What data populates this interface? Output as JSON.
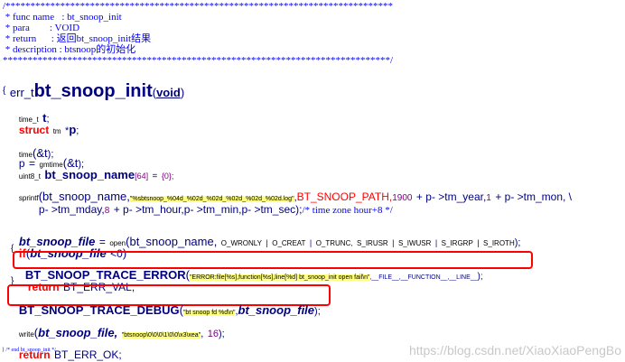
{
  "header": {
    "line1": "/******************************************************************************",
    "line2": " * func name   : bt_snoop_init",
    "line3": " * para        : VOID",
    "line4": " * return      : 返回bt_snoop_init结果",
    "line5": " * description : btsnoop的初始化",
    "line6": "******************************************************************************/"
  },
  "sig": {
    "ret": "err_t",
    "name": "bt_snoop_init",
    "paren_open": "(",
    "arg": "void",
    "paren_close": ")"
  },
  "brace_open": "{",
  "decl1": {
    "type": "time_t",
    "var": "t",
    "semi": ";"
  },
  "decl2": {
    "kw": "struct",
    "type": "tm",
    "star": "*",
    "var": "p",
    "semi": ";"
  },
  "call_time": {
    "fn": "time",
    "open": "(",
    "arg": "&t",
    "close": ");"
  },
  "call_gm": {
    "lhs": "p",
    "eq": "=",
    "fn": "gmtime",
    "open": "(",
    "arg": "&t",
    "close": ");"
  },
  "decl3": {
    "type": "uint8_t",
    "var": "bt_snoop_name",
    "dim": "[64]",
    "eq": "=",
    "init": "{0};"
  },
  "sprintf": {
    "fn": "sprintf",
    "open": "(",
    "arg1": "bt_snoop_name,",
    "fmt": "\"%sbtsnoop_%04d_%02d_%02d_%02d_%02d_%02d.log\"",
    "comma1": ",",
    "path": "BT_SNOOP_PATH,",
    "n1900": "1900",
    "rest1": "+ p- >tm_year,",
    "n1": "1",
    "rest2": "+ p- >tm_mon, \\",
    "rest3": "p- >tm_mday,",
    "n8": "8",
    "rest4": "+ p- >tm_hour,p- >tm_min,p- >tm_sec);",
    "comment": "/* time zone hour+8 */"
  },
  "open_line": {
    "lhs": "bt_snoop_file",
    "eq": "=",
    "fn": "open",
    "open": "(",
    "arg": "bt_snoop_name,",
    "f1": "O_WRONLY",
    "f2": "O_CREAT",
    "f3": "O_TRUNC,",
    "f4": "S_IRUSR",
    "f5": "S_IWUSR",
    "f6": "S_IRGRP",
    "f7": "S_IROTH",
    "pipe": "|",
    "close": ");"
  },
  "if_line": {
    "kw": "if",
    "open": "(",
    "var": "bt_snoop_file",
    "cmp": "<0",
    "close": ")"
  },
  "inner_brace": "{",
  "trace_err": {
    "fn": "BT_SNOOP_TRACE_ERROR",
    "open": "(",
    "msg": "\"ERROR:file[%s],function[%s],line[%d] bt_snoop_init open fail\\n\"",
    "args": ",__FILE__,__FUNCTION__,__LINE__",
    "close": ");"
  },
  "ret_err": {
    "kw": "return",
    "val": "BT_ERR_VAL;"
  },
  "inner_brace_close": "}",
  "trace_dbg": {
    "fn": "BT_SNOOP_TRACE_DEBUG",
    "open": "(",
    "msg": "\"bt snoop fd %d\\n\"",
    "comma": ",",
    "var": "bt_snoop_file",
    "close": ");"
  },
  "write_line": {
    "fn": "write",
    "open": "(",
    "var": "bt_snoop_file,",
    "str": "\"btsnoop\\0\\0\\0\\1\\0\\0\\x3\\xea\"",
    "comma": ",",
    "num": "16",
    "close": ");"
  },
  "ret_ok": {
    "kw": "return",
    "val": "BT_ERR_OK;"
  },
  "footer": "} /* end bt_snoop_init */",
  "watermark": "https://blog.csdn.net/XiaoXiaoPengBo"
}
